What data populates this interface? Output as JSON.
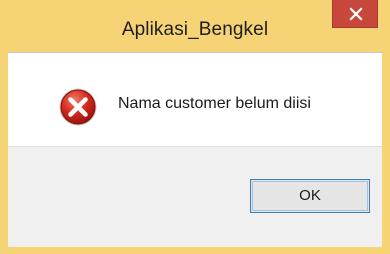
{
  "window": {
    "title": "Aplikasi_Bengkel",
    "close_icon": "close-icon"
  },
  "message": {
    "icon": "error-icon",
    "text": "Nama customer belum diisi"
  },
  "buttons": {
    "ok_label": "OK"
  },
  "colors": {
    "titlebar": "#f6d374",
    "close_button": "#c7483b",
    "footer": "#f0f0f0",
    "button_border": "#3c7fb1"
  }
}
